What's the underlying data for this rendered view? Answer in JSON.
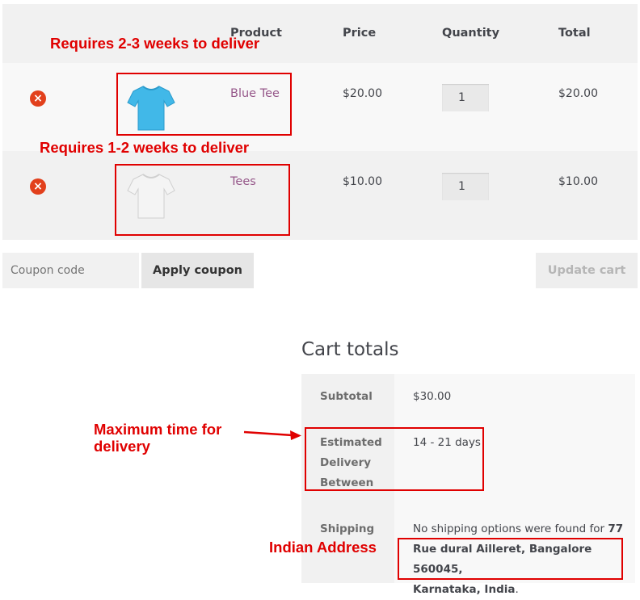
{
  "cart": {
    "headers": {
      "product": "Product",
      "price": "Price",
      "quantity": "Quantity",
      "total": "Total"
    },
    "items": [
      {
        "name": "Blue Tee",
        "price": "$20.00",
        "quantity": "1",
        "total": "$20.00",
        "remove_icon": "×",
        "thumb_icon": "blue-tshirt-icon",
        "thumb_color": "#41b8e8"
      },
      {
        "name": "Tees",
        "price": "$10.00",
        "quantity": "1",
        "total": "$10.00",
        "remove_icon": "×",
        "thumb_icon": "white-tshirt-icon",
        "thumb_color": "#f4f4f4"
      }
    ],
    "coupon_placeholder": "Coupon code",
    "apply_coupon_label": "Apply coupon",
    "update_cart_label": "Update cart"
  },
  "totals": {
    "title": "Cart totals",
    "subtotal_label": "Subtotal",
    "subtotal_value": "$30.00",
    "delivery_label_1": "Estimated",
    "delivery_label_2": "Delivery",
    "delivery_label_3": "Between",
    "delivery_value": "14 - 21 days",
    "shipping_label": "Shipping",
    "shipping_line_1_text": "No shipping options were found for ",
    "shipping_line_1_bold": "77",
    "shipping_line_2": "Rue dural Ailleret, Bangalore 560045,",
    "shipping_line_3_bold": "Karnataka, India",
    "shipping_line_3_end": "."
  },
  "annotations": {
    "blue_tee_note": "Requires 2-3 weeks to deliver",
    "tees_note": "Requires 1-2 weeks to deliver",
    "max_time_line_1": "Maximum time for",
    "max_time_line_2": "delivery",
    "indian_address": "Indian Address"
  },
  "colors": {
    "accent_link": "#96588a",
    "remove": "#e2401c",
    "annotation": "#e00000"
  }
}
